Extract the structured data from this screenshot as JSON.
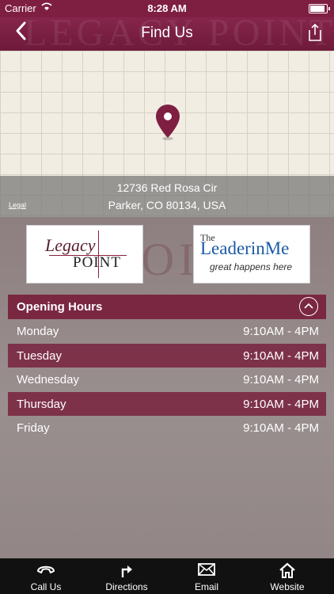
{
  "status_bar": {
    "carrier": "Carrier",
    "time": "8:28 AM"
  },
  "nav": {
    "title": "Find Us",
    "watermark": "LEGACY POINT"
  },
  "map": {
    "legal": "Legal",
    "address_line1": "12736 Red Rosa Cir",
    "address_line2": "Parker, CO 80134, USA"
  },
  "logos": {
    "legacy_word": "Legacy",
    "point_word": "POINT",
    "leader_the": "The",
    "leader_main": "LeaderinMe",
    "leader_tagline": "great happens here",
    "watermark": "POINT"
  },
  "hours": {
    "title": "Opening Hours",
    "rows": [
      {
        "day": "Monday",
        "time": "9:10AM - 4PM"
      },
      {
        "day": "Tuesday",
        "time": "9:10AM - 4PM"
      },
      {
        "day": "Wednesday",
        "time": "9:10AM - 4PM"
      },
      {
        "day": "Thursday",
        "time": "9:10AM - 4PM"
      },
      {
        "day": "Friday",
        "time": "9:10AM - 4PM"
      }
    ]
  },
  "tabs": [
    {
      "label": "Call Us",
      "icon": "phone-icon"
    },
    {
      "label": "Directions",
      "icon": "directions-icon"
    },
    {
      "label": "Email",
      "icon": "envelope-icon"
    },
    {
      "label": "Website",
      "icon": "home-icon"
    }
  ],
  "colors": {
    "brand": "#7e1f42",
    "row_alt": "#78223e",
    "tabbar": "#111111"
  }
}
